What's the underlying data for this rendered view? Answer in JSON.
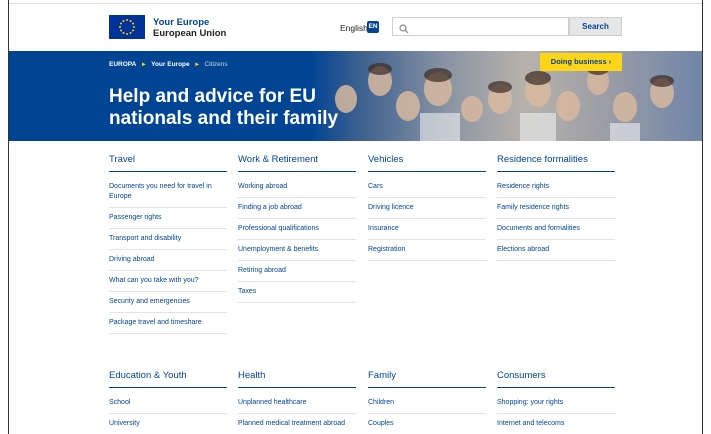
{
  "header": {
    "site_name_line1": "Your Europe",
    "site_name_line2": "European Union",
    "language": "English",
    "language_code": "EN",
    "search_placeholder": "",
    "search_button": "Search"
  },
  "hero": {
    "breadcrumb": [
      "EUROPA",
      "Your Europe",
      "Citizens"
    ],
    "title": "Help and advice for EU nationals and their family",
    "business_button": "Doing business"
  },
  "sections": [
    {
      "title": "Travel",
      "links": [
        "Documents you need for travel in Europe",
        "Passenger rights",
        "Transport and disability",
        "Driving abroad",
        "What can you take with you?",
        "Security and emergencies",
        "Package travel and timeshare"
      ]
    },
    {
      "title": "Work & Retirement",
      "links": [
        "Working abroad",
        "Finding a job abroad",
        "Professional qualifications",
        "Unemployment & benefits",
        "Retiring abroad",
        "Taxes"
      ]
    },
    {
      "title": "Vehicles",
      "links": [
        "Cars",
        "Driving licence",
        "Insurance",
        "Registration"
      ]
    },
    {
      "title": "Residence formalities",
      "links": [
        "Residence rights",
        "Family residence rights",
        "Documents and formalities",
        "Elections abroad"
      ]
    },
    {
      "title": "Education & Youth",
      "links": [
        "School",
        "University"
      ]
    },
    {
      "title": "Health",
      "links": [
        "Unplanned healthcare",
        "Planned medical treatment abroad"
      ]
    },
    {
      "title": "Family",
      "links": [
        "Children",
        "Couples"
      ]
    },
    {
      "title": "Consumers",
      "links": [
        "Shopping: your rights",
        "Internet and telecoms"
      ]
    }
  ],
  "colors": {
    "brand_blue": "#004494",
    "accent_yellow": "#ffd617"
  }
}
